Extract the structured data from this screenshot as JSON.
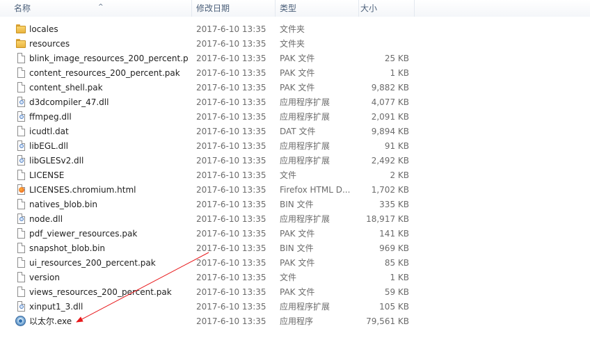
{
  "columns": {
    "name": "名称",
    "date": "修改日期",
    "type": "类型",
    "size": "大小",
    "sort_indicator": "^"
  },
  "files": [
    {
      "name": "locales",
      "date": "2017-6-10 13:35",
      "type": "文件夹",
      "size": "",
      "icon": "folder-icon"
    },
    {
      "name": "resources",
      "date": "2017-6-10 13:35",
      "type": "文件夹",
      "size": "",
      "icon": "folder-icon"
    },
    {
      "name": "blink_image_resources_200_percent.p...",
      "date": "2017-6-10 13:35",
      "type": "PAK 文件",
      "size": "25 KB",
      "icon": "file-icon"
    },
    {
      "name": "content_resources_200_percent.pak",
      "date": "2017-6-10 13:35",
      "type": "PAK 文件",
      "size": "1 KB",
      "icon": "file-icon"
    },
    {
      "name": "content_shell.pak",
      "date": "2017-6-10 13:35",
      "type": "PAK 文件",
      "size": "9,882 KB",
      "icon": "file-icon"
    },
    {
      "name": "d3dcompiler_47.dll",
      "date": "2017-6-10 13:35",
      "type": "应用程序扩展",
      "size": "4,077 KB",
      "icon": "dll-icon"
    },
    {
      "name": "ffmpeg.dll",
      "date": "2017-6-10 13:35",
      "type": "应用程序扩展",
      "size": "2,091 KB",
      "icon": "dll-icon"
    },
    {
      "name": "icudtl.dat",
      "date": "2017-6-10 13:35",
      "type": "DAT 文件",
      "size": "9,894 KB",
      "icon": "file-icon"
    },
    {
      "name": "libEGL.dll",
      "date": "2017-6-10 13:35",
      "type": "应用程序扩展",
      "size": "91 KB",
      "icon": "dll-icon"
    },
    {
      "name": "libGLESv2.dll",
      "date": "2017-6-10 13:35",
      "type": "应用程序扩展",
      "size": "2,492 KB",
      "icon": "dll-icon"
    },
    {
      "name": "LICENSE",
      "date": "2017-6-10 13:35",
      "type": "文件",
      "size": "2 KB",
      "icon": "file-icon"
    },
    {
      "name": "LICENSES.chromium.html",
      "date": "2017-6-10 13:35",
      "type": "Firefox HTML D...",
      "size": "1,702 KB",
      "icon": "firefox-html-icon"
    },
    {
      "name": "natives_blob.bin",
      "date": "2017-6-10 13:35",
      "type": "BIN 文件",
      "size": "335 KB",
      "icon": "file-icon"
    },
    {
      "name": "node.dll",
      "date": "2017-6-10 13:35",
      "type": "应用程序扩展",
      "size": "18,917 KB",
      "icon": "dll-icon"
    },
    {
      "name": "pdf_viewer_resources.pak",
      "date": "2017-6-10 13:35",
      "type": "PAK 文件",
      "size": "141 KB",
      "icon": "file-icon"
    },
    {
      "name": "snapshot_blob.bin",
      "date": "2017-6-10 13:35",
      "type": "BIN 文件",
      "size": "969 KB",
      "icon": "file-icon"
    },
    {
      "name": "ui_resources_200_percent.pak",
      "date": "2017-6-10 13:35",
      "type": "PAK 文件",
      "size": "85 KB",
      "icon": "file-icon"
    },
    {
      "name": "version",
      "date": "2017-6-10 13:35",
      "type": "文件",
      "size": "1 KB",
      "icon": "file-icon"
    },
    {
      "name": "views_resources_200_percent.pak",
      "date": "2017-6-10 13:35",
      "type": "PAK 文件",
      "size": "59 KB",
      "icon": "file-icon"
    },
    {
      "name": "xinput1_3.dll",
      "date": "2017-6-10 13:35",
      "type": "应用程序扩展",
      "size": "105 KB",
      "icon": "dll-icon"
    },
    {
      "name": "以太尔.exe",
      "date": "2017-6-10 13:35",
      "type": "应用程序",
      "size": "79,561 KB",
      "icon": "exe-icon"
    }
  ],
  "colors": {
    "header_text": "#4c607a",
    "meta_text": "#6b6b6b",
    "annotation_arrow": "#e8191c",
    "folder": "#f3c355"
  }
}
